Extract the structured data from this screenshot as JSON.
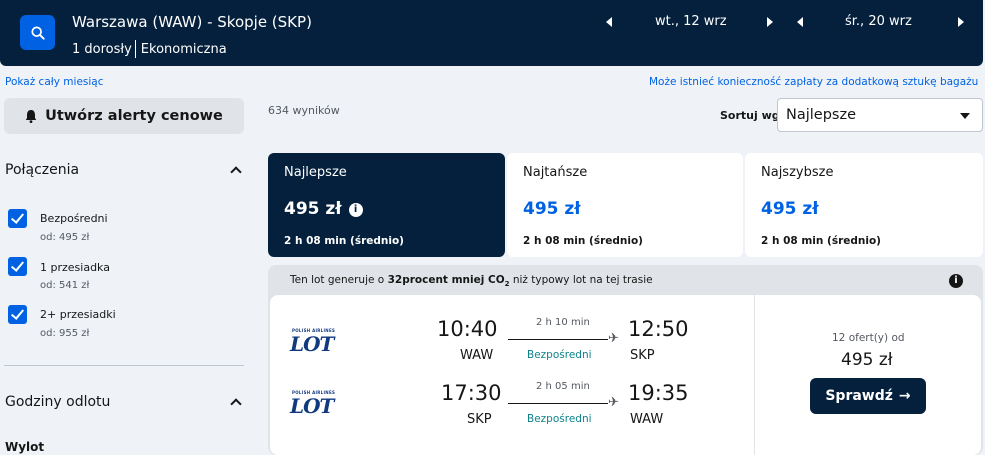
{
  "header": {
    "route": "Warszawa (WAW) - Skopje (SKP)",
    "passengers": "1 dorosły",
    "cabin": "Ekonomiczna",
    "depart_date": "wt., 12 wrz",
    "return_date": "śr., 20 wrz",
    "search_icon": "search-icon",
    "accent_color": "#0062e3",
    "navy_color": "#05203c"
  },
  "links": {
    "whole_month": "Pokaż cały miesiąc",
    "baggage_notice": "Może istnieć konieczność zapłaty za dodatkową sztukę bagażu"
  },
  "sidebar": {
    "alert_button": "Utwórz alerty cenowe",
    "alert_icon": "bell-icon",
    "connections_title": "Połączenia",
    "stops": [
      {
        "label": "Bezpośredni",
        "price": "od: 495 zł",
        "checked": true
      },
      {
        "label": "1 przesiadka",
        "price": "od: 541 zł",
        "checked": true
      },
      {
        "label": "2+ przesiadki",
        "price": "od: 955 zł",
        "checked": true
      }
    ],
    "departure_title": "Godziny odlotu",
    "departure_sub": "Wylot"
  },
  "results": {
    "count": "634 wyników",
    "sort_label": "Sortuj wg",
    "sort_value": "Najlepsze"
  },
  "tabs": [
    {
      "title": "Najlepsze",
      "price": "495 zł",
      "duration": "2 h 08 min (średnio)",
      "active": true
    },
    {
      "title": "Najtańsze",
      "price": "495 zł",
      "duration": "2 h 08 min (średnio)",
      "active": false
    },
    {
      "title": "Najszybsze",
      "price": "495 zł",
      "duration": "2 h 08 min (średnio)",
      "active": false
    }
  ],
  "card": {
    "co2_prefix": "Ten lot generuje o",
    "co2_bold": "32procent mniej CO",
    "co2_sub": "2",
    "co2_suffix": "niż typowy lot na tej trasie",
    "airline_small": "POLISH AIRLINES",
    "airline_logo": "LOT",
    "legs": [
      {
        "dep_time": "10:40",
        "dep_iata": "WAW",
        "duration": "2 h 10 min",
        "stops": "Bezpośredni",
        "arr_time": "12:50",
        "arr_iata": "SKP"
      },
      {
        "dep_time": "17:30",
        "dep_iata": "SKP",
        "duration": "2 h 05 min",
        "stops": "Bezpośredni",
        "arr_time": "19:35",
        "arr_iata": "WAW"
      }
    ],
    "offers": "12 ofert(y) od",
    "price": "495 zł",
    "button": "Sprawdź"
  }
}
